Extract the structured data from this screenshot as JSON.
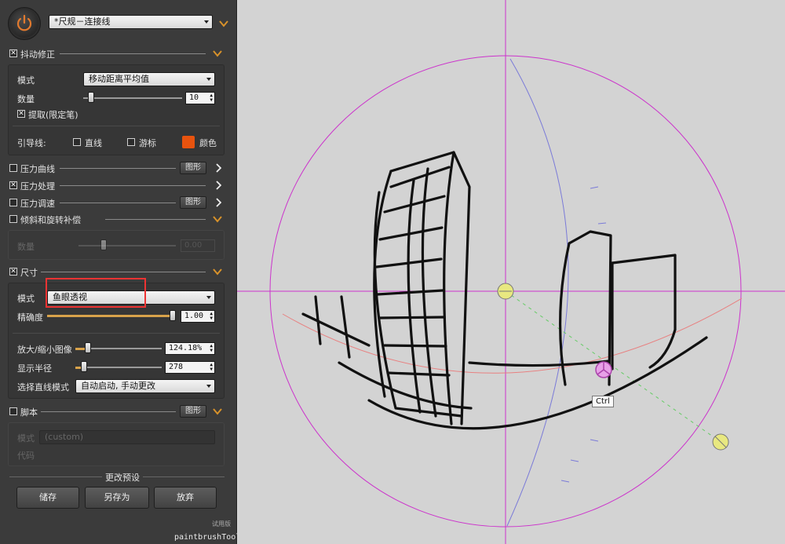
{
  "preset": {
    "value": "*尺规－连接线"
  },
  "stabilizer": {
    "title": "抖动修正",
    "checked": true,
    "mode_label": "模式",
    "mode_value": "移动距离平均值",
    "amount_label": "数量",
    "amount_value": "10",
    "amount_level": 0.05,
    "catchup_label": "提取(限定笔)",
    "catchup_checked": true,
    "guide_label": "引导线:",
    "straight_label": "直线",
    "cursor_label": "游标",
    "color_label": "颜色"
  },
  "pressure_curve": {
    "title": "压力曲线",
    "button": "图形",
    "checked": false
  },
  "pressure_proc": {
    "title": "压力处理",
    "checked": true
  },
  "pressure_speed": {
    "title": "压力调速",
    "button": "图形",
    "checked": false
  },
  "tilt": {
    "title": "倾斜和旋转补偿",
    "checked": false,
    "amount_label": "数量",
    "amount_value": "0.00"
  },
  "ruler": {
    "title": "尺寸",
    "checked": true,
    "mode_label": "模式",
    "mode_value": "鱼眼透视",
    "precision_label": "精确度",
    "precision_value": "1.00",
    "precision_level": 1.0,
    "zoom_label": "放大/缩小图像",
    "zoom_value": "124.18%",
    "zoom_level": 0.12,
    "radius_label": "显示半径",
    "radius_value": "278",
    "radius_level": 0.08,
    "line_mode_label": "选择直线模式",
    "line_mode_value": "自动启动, 手动更改"
  },
  "script": {
    "title": "脚本",
    "button": "图形",
    "checked": false,
    "mode_label": "模式",
    "mode_value": "(custom)",
    "code_label": "代码"
  },
  "presets": {
    "title": "更改预设",
    "save": "储存",
    "save_as": "另存为",
    "discard": "放弃"
  },
  "trial_label": "试用版",
  "app_name": "paintbrushTool",
  "canvas": {
    "tooltip": "Ctrl"
  },
  "colors": {
    "accent": "#d8a24a",
    "swatch": "#e8530e",
    "circle": "#cc33cc",
    "highlight": "#e33333"
  }
}
